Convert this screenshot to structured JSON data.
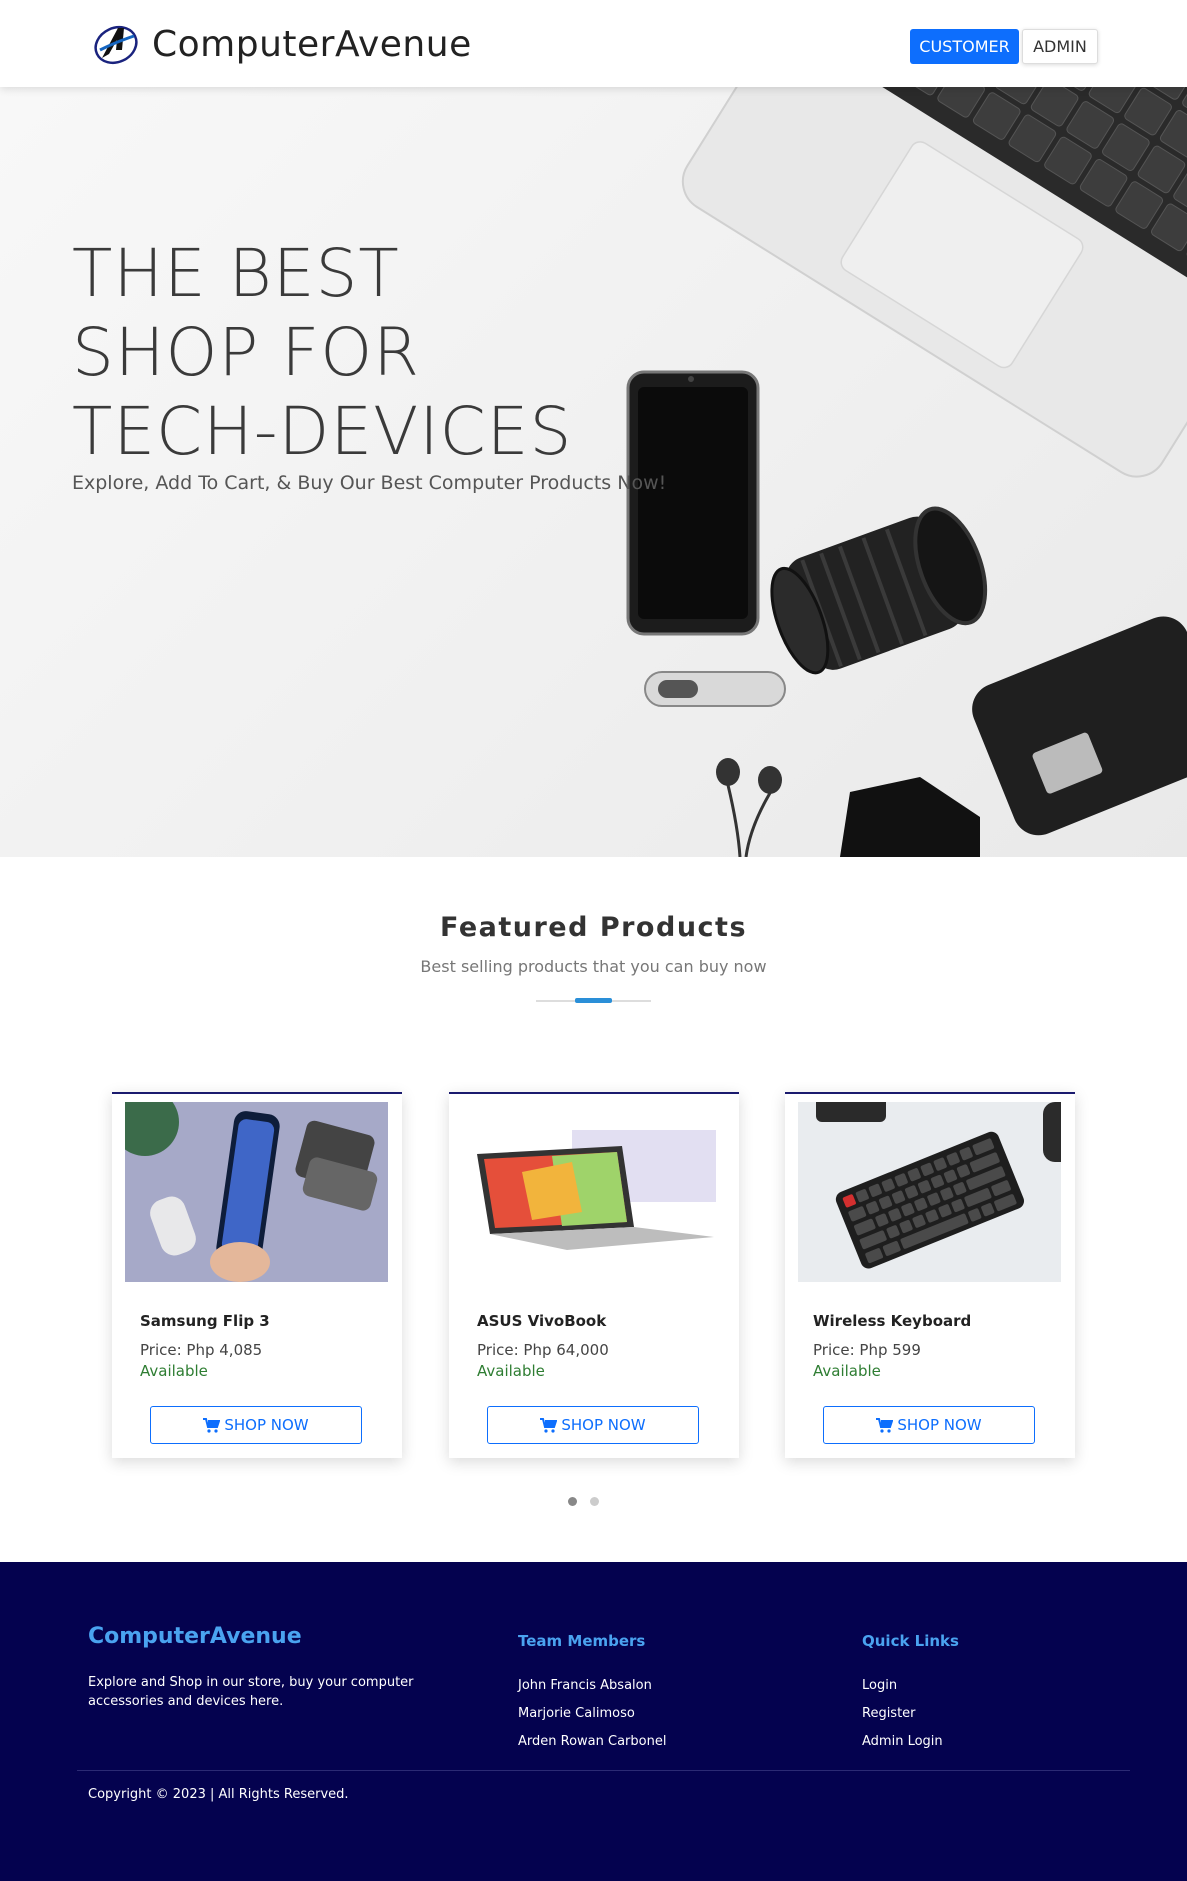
{
  "navbar": {
    "brand": "ComputerAvenue",
    "logo_icon": "computeravenue-logo-icon",
    "customer_label": "CUSTOMER",
    "admin_label": "ADMIN",
    "accent_color": "#0d6efd"
  },
  "hero": {
    "title_line1": "THE BEST",
    "title_line2": "SHOP FOR",
    "title_line3": "TECH-DEVICES",
    "subtitle": "Explore, Add To Cart, & Buy Our Best Computer Products Now!"
  },
  "featured": {
    "title": "Featured Products",
    "subtitle": "Best selling products that you can buy now",
    "accent_color": "#2a8fd8"
  },
  "products": [
    {
      "name": "Samsung Flip 3",
      "price": "Price: Php 4,085",
      "status": "Available",
      "button": "SHOP NOW"
    },
    {
      "name": "ASUS VivoBook",
      "price": "Price: Php 64,000",
      "status": "Available",
      "button": "SHOP NOW"
    },
    {
      "name": "Wireless Keyboard",
      "price": "Price: Php 599",
      "status": "Available",
      "button": "SHOP NOW"
    }
  ],
  "carousel": {
    "pages": 2,
    "active": 1
  },
  "footer": {
    "brand": "ComputerAvenue",
    "description": "Explore and Shop in our store, buy your computer accessories and devices here.",
    "team_title": "Team Members",
    "team": [
      "John Francis Absalon",
      "Marjorie Calimoso",
      "Arden Rowan Carbonel"
    ],
    "links_title": "Quick Links",
    "links": [
      "Login",
      "Register",
      "Admin Login"
    ],
    "copyright": "Copyright © 2023 | All Rights Reserved.",
    "background_color": "#04024f"
  }
}
